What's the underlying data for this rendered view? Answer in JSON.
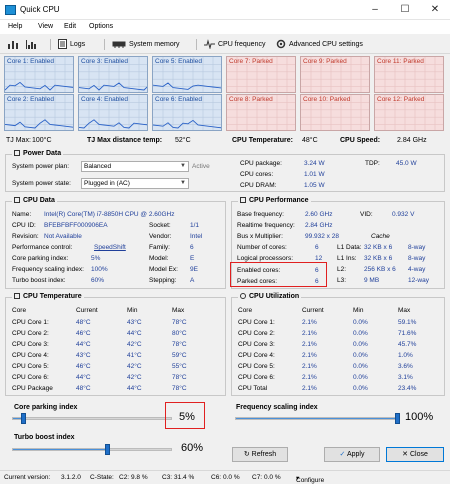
{
  "window": {
    "title": "Quick CPU",
    "controls": [
      "minimize",
      "maximize",
      "close"
    ]
  },
  "menu": [
    "Help",
    "View",
    "Edit",
    "Options"
  ],
  "toolbar": {
    "logs_label": "Logs",
    "system_memory_label": "System memory",
    "cpu_frequency_label": "CPU frequency",
    "advanced_cpu_settings_label": "Advanced CPU settings"
  },
  "cores": [
    {
      "label": "Core 1: Enabled",
      "state": "enabled"
    },
    {
      "label": "Core 3: Enabled",
      "state": "enabled"
    },
    {
      "label": "Core 5: Enabled",
      "state": "enabled"
    },
    {
      "label": "Core 7: Parked",
      "state": "parked"
    },
    {
      "label": "Core 9: Parked",
      "state": "parked"
    },
    {
      "label": "Core 11: Parked",
      "state": "parked"
    },
    {
      "label": "Core 2: Enabled",
      "state": "enabled"
    },
    {
      "label": "Core 4: Enabled",
      "state": "enabled"
    },
    {
      "label": "Core 6: Enabled",
      "state": "enabled"
    },
    {
      "label": "Core 8: Parked",
      "state": "parked"
    },
    {
      "label": "Core 10: Parked",
      "state": "parked"
    },
    {
      "label": "Core 12: Parked",
      "state": "parked"
    }
  ],
  "status_line": {
    "tj_max_label": "TJ Max:",
    "tj_max_value": "100°C",
    "tj_distance_label": "TJ Max distance temp:",
    "tj_distance_value": "52°C",
    "cpu_temp_label": "CPU Temperature:",
    "cpu_temp_value": "48°C",
    "cpu_speed_label": "CPU Speed:",
    "cpu_speed_value": "2.84 GHz"
  },
  "power_data": {
    "title": "Power Data",
    "plan_label": "System power plan:",
    "plan_value": "Balanced",
    "plan_state": "Active",
    "state_label": "System power state:",
    "state_value": "Plugged in (AC)",
    "cpu_package_label": "CPU package:",
    "cpu_package_value": "3.24 W",
    "cpu_cores_label": "CPU cores:",
    "cpu_cores_value": "1.01 W",
    "cpu_dram_label": "CPU DRAM:",
    "cpu_dram_value": "1.05 W",
    "tdp_label": "TDP:",
    "tdp_value": "45.0 W"
  },
  "cpu_data": {
    "title": "CPU Data",
    "rows": [
      {
        "label": "Name:",
        "value": "Intel(R) Core(TM) i7-8850H CPU @ 2.60GHz"
      },
      {
        "label": "CPU ID:",
        "value": "BFEBFBFF000906EA"
      },
      {
        "label": "Revision:",
        "value": "Not Available"
      },
      {
        "label": "Performance control:",
        "value": "SpeedShift"
      },
      {
        "label": "Core parking index:",
        "value": "5%"
      },
      {
        "label": "Frequency scaling index:",
        "value": "100%"
      },
      {
        "label": "Turbo boost index:",
        "value": "60%"
      }
    ],
    "right_rows": [
      {
        "label": "Socket:",
        "value": "1/1"
      },
      {
        "label": "Vendor:",
        "value": "Intel"
      },
      {
        "label": "Family:",
        "value": "6"
      },
      {
        "label": "Model:",
        "value": "E"
      },
      {
        "label": "Model Ex:",
        "value": "9E"
      },
      {
        "label": "Stepping:",
        "value": "A"
      }
    ]
  },
  "cpu_performance": {
    "title": "CPU Performance",
    "base_freq_label": "Base frequency:",
    "base_freq_value": "2.60 GHz",
    "vid_label": "VID:",
    "vid_value": "0.932 V",
    "realtime_label": "Realtime frequency:",
    "realtime_value": "2.84 GHz",
    "bus_label": "Bus x Multiplier:",
    "bus_value": "99.932 x 28",
    "cache_label": "Cache",
    "num_cores_label": "Number of cores:",
    "num_cores_value": "6",
    "logical_label": "Logical processors:",
    "logical_value": "12",
    "enabled_label": "Enabled cores:",
    "enabled_value": "6",
    "parked_label": "Parked cores:",
    "parked_value": "6",
    "cache_rows": [
      {
        "label": "L1 Data:",
        "value": "32 KB x 6",
        "assoc": "8-way"
      },
      {
        "label": "L1 Ins:",
        "value": "32 KB x 6",
        "assoc": "8-way"
      },
      {
        "label": "L2:",
        "value": "256 KB x 6",
        "assoc": "4-way"
      },
      {
        "label": "L3:",
        "value": "9 MB",
        "assoc": "12-way"
      }
    ]
  },
  "cpu_temperature": {
    "title": "CPU Temperature",
    "headers": [
      "Core",
      "Current",
      "Min",
      "Max"
    ],
    "rows": [
      [
        "CPU Core 1:",
        "48°C",
        "43°C",
        "78°C"
      ],
      [
        "CPU Core 2:",
        "46°C",
        "44°C",
        "80°C"
      ],
      [
        "CPU Core 3:",
        "44°C",
        "42°C",
        "78°C"
      ],
      [
        "CPU Core 4:",
        "43°C",
        "41°C",
        "59°C"
      ],
      [
        "CPU Core 5:",
        "46°C",
        "42°C",
        "55°C"
      ],
      [
        "CPU Core 6:",
        "44°C",
        "42°C",
        "78°C"
      ],
      [
        "CPU Package",
        "48°C",
        "44°C",
        "78°C"
      ]
    ]
  },
  "cpu_utilization": {
    "title": "CPU Utilization",
    "headers": [
      "Core",
      "Current",
      "Min",
      "Max"
    ],
    "rows": [
      [
        "CPU Core 1:",
        "2.1%",
        "0.0%",
        "59.1%"
      ],
      [
        "CPU Core 2:",
        "2.1%",
        "0.0%",
        "71.6%"
      ],
      [
        "CPU Core 3:",
        "2.1%",
        "0.0%",
        "45.7%"
      ],
      [
        "CPU Core 4:",
        "2.1%",
        "0.0%",
        "1.0%"
      ],
      [
        "CPU Core 5:",
        "2.1%",
        "0.0%",
        "3.6%"
      ],
      [
        "CPU Core 6:",
        "2.1%",
        "0.0%",
        "3.1%"
      ],
      [
        "CPU Total",
        "2.1%",
        "0.0%",
        "23.4%"
      ]
    ]
  },
  "sliders": {
    "core_parking": {
      "label": "Core parking index",
      "value": 5,
      "text": "5%"
    },
    "frequency_scaling": {
      "label": "Frequency scaling index",
      "value": 100,
      "text": "100%"
    },
    "turbo_boost": {
      "label": "Turbo boost index",
      "value": 60,
      "text": "60%"
    }
  },
  "buttons": {
    "refresh": "Refresh",
    "apply": "Apply",
    "close": "Close"
  },
  "statusbar": {
    "version_label": "Current version:",
    "version_value": "3.1.2.0",
    "cstate_label": "C-State:",
    "c2_label": "C2:",
    "c2_value": "9.8 %",
    "c3_label": "C3:",
    "c3_value": "31.4 %",
    "c6_label": "C6:",
    "c6_value": "0.0 %",
    "c7_label": "C7:",
    "c7_value": "0.0 %",
    "configure_label": "Configure"
  },
  "colors": {
    "accent": "#1f6fc8",
    "parked": "#c0392b",
    "highlight": "#e02020"
  }
}
